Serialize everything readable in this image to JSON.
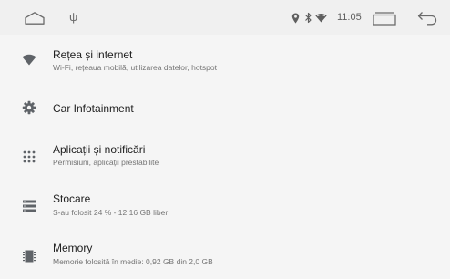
{
  "status_bar": {
    "time": "11:05",
    "icons": [
      "home-icon",
      "usb-icon",
      "location-icon",
      "bluetooth-icon",
      "wifi-icon",
      "recents-icon",
      "back-icon"
    ]
  },
  "settings": {
    "items": [
      {
        "icon": "wifi-icon",
        "title": "Rețea și internet",
        "subtitle": "Wi-Fi, rețeaua mobilă, utilizarea datelor, hotspot"
      },
      {
        "icon": "gear-icon",
        "title": "Car Infotainment",
        "subtitle": ""
      },
      {
        "icon": "apps-grid-icon",
        "title": "Aplicații și notificări",
        "subtitle": "Permisiuni, aplicații prestabilite"
      },
      {
        "icon": "storage-icon",
        "title": "Stocare",
        "subtitle": "S-au folosit 24 % - 12,16 GB liber"
      },
      {
        "icon": "memory-icon",
        "title": "Memory",
        "subtitle": "Memorie folosită în medie: 0,92 GB din 2,0 GB"
      }
    ]
  },
  "colors": {
    "background": "#f5f5f5",
    "status_bar": "#f0f0f0",
    "icon": "#5f6368",
    "title": "#212121",
    "subtitle": "#757575"
  }
}
